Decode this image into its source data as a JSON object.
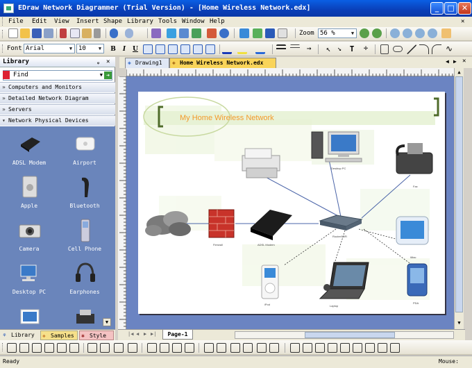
{
  "window": {
    "title": "EDraw Network Diagrammer (Trial Version) - [Home Wireless Network.edx]",
    "minimize": "_",
    "maximize": "□",
    "close": "✕"
  },
  "menu": [
    "File",
    "Edit",
    "View",
    "Insert",
    "Shape",
    "Library",
    "Tools",
    "Window",
    "Help"
  ],
  "toolbar": {
    "zoom_label": "Zoom",
    "zoom_value": "56 %"
  },
  "format": {
    "font_label": "Font",
    "font_value": "Arial",
    "size_value": "10",
    "bold": "B",
    "italic": "I",
    "underline": "U"
  },
  "library": {
    "title": "Library",
    "find_value": "Find",
    "categories": [
      "Computers and Monitors",
      "Detailed Network Diagram",
      "Servers",
      "Network Physical Devices"
    ],
    "shapes": [
      "ADSL Modem",
      "Airport",
      "Apple",
      "Bluetooth",
      "Camera",
      "Cell Phone",
      "Desktop PC",
      "Earphones"
    ],
    "tabs": [
      "Library",
      "Samples",
      "Style"
    ]
  },
  "doc_tabs": [
    "Drawing1",
    "Home Wireless Network.edx"
  ],
  "diagram": {
    "title": "My Home Wireless Network",
    "labels": {
      "router": "Router/WiFi",
      "modem": "ADSL Modem",
      "firewall": "Firewall",
      "server": "Workstation",
      "fax": "Fax",
      "imac": "iMac",
      "ipod": "iPod",
      "laptop": "Laptop",
      "pda": "PDA",
      "desktop": "Desktop PC"
    }
  },
  "page_tab": "Page-1",
  "status": {
    "left": "Ready",
    "right": "Mouse:"
  },
  "colors": {
    "title_blue": "#0a45d0",
    "canvas_bg": "#6b84c2",
    "library_bg": "#6a85bb",
    "diagram_title": "#f39a2a"
  }
}
